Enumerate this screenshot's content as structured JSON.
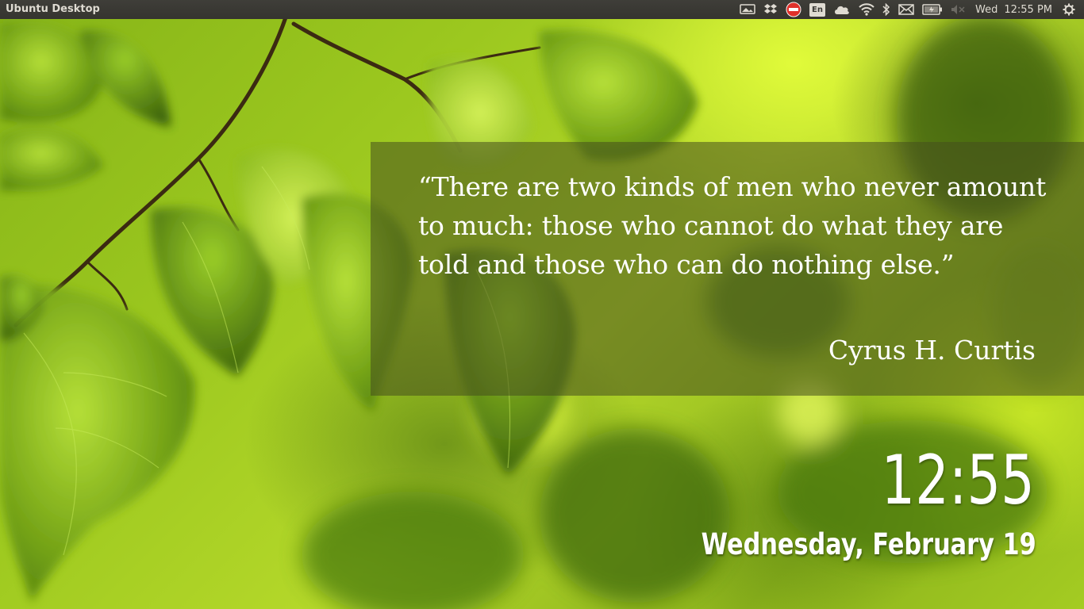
{
  "panel": {
    "title": "Ubuntu Desktop",
    "keyboard_layout": "En",
    "day": "Wed",
    "time": "12:55 PM",
    "indicators": [
      "display-icon",
      "dropbox-icon",
      "no-entry-icon",
      "keyboard-layout-indicator",
      "cloud-icon",
      "wifi-icon",
      "bluetooth-icon",
      "mail-icon",
      "battery-icon",
      "volume-muted-icon",
      "system-gear-icon"
    ]
  },
  "quote": {
    "text": "“There are two kinds of men who never amount to much: those who cannot do what they are told and those who can do nothing else.”",
    "author": "Cyrus H. Curtis"
  },
  "clock": {
    "time": "12:55",
    "date": "Wednesday, February 19"
  },
  "colors": {
    "panel_background": "#3c3b37",
    "panel_text": "#dfdbd2",
    "stop_red": "#e0302a",
    "wallpaper_green": "#9cc81f",
    "quote_overlay": "#464e1e"
  }
}
